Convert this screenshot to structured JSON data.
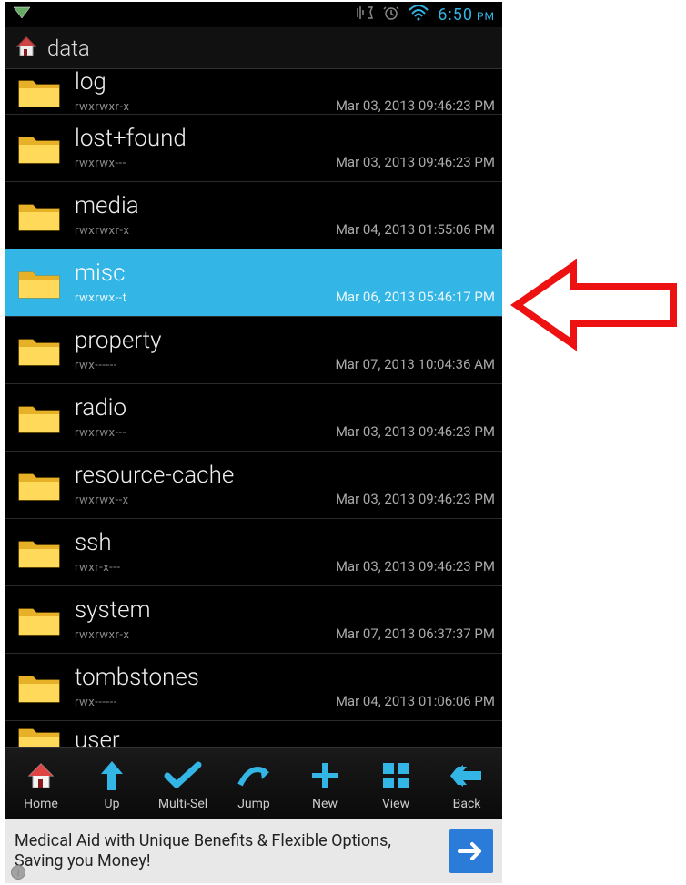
{
  "status": {
    "time": "6:50",
    "ampm": "PM"
  },
  "path": {
    "label": "data"
  },
  "files": [
    {
      "name": "log",
      "perms": "rwxrwxr-x",
      "date": "Mar 03, 2013 09:46:23 PM",
      "selected": false
    },
    {
      "name": "lost+found",
      "perms": "rwxrwx---",
      "date": "Mar 03, 2013 09:46:23 PM",
      "selected": false
    },
    {
      "name": "media",
      "perms": "rwxrwxr-x",
      "date": "Mar 04, 2013 01:55:06 PM",
      "selected": false
    },
    {
      "name": "misc",
      "perms": "rwxrwx--t",
      "date": "Mar 06, 2013 05:46:17 PM",
      "selected": true
    },
    {
      "name": "property",
      "perms": "rwx------",
      "date": "Mar 07, 2013 10:04:36 AM",
      "selected": false
    },
    {
      "name": "radio",
      "perms": "rwxrwx---",
      "date": "Mar 03, 2013 09:46:23 PM",
      "selected": false
    },
    {
      "name": "resource-cache",
      "perms": "rwxrwx--x",
      "date": "Mar 03, 2013 09:46:23 PM",
      "selected": false
    },
    {
      "name": "ssh",
      "perms": "rwxr-x---",
      "date": "Mar 03, 2013 09:46:23 PM",
      "selected": false
    },
    {
      "name": "system",
      "perms": "rwxrwxr-x",
      "date": "Mar 07, 2013 06:37:37 PM",
      "selected": false
    },
    {
      "name": "tombstones",
      "perms": "rwx------",
      "date": "Mar 04, 2013 01:06:06 PM",
      "selected": false
    },
    {
      "name": "user",
      "perms": "",
      "date": "",
      "selected": false
    }
  ],
  "toolbar": [
    {
      "key": "home",
      "label": "Home"
    },
    {
      "key": "up",
      "label": "Up"
    },
    {
      "key": "multisel",
      "label": "Multi-Sel"
    },
    {
      "key": "jump",
      "label": "Jump"
    },
    {
      "key": "new",
      "label": "New"
    },
    {
      "key": "view",
      "label": "View"
    },
    {
      "key": "back",
      "label": "Back"
    }
  ],
  "ad": {
    "text": "Medical Aid with Unique Benefits & Flexible Options, Saving you Money!"
  }
}
